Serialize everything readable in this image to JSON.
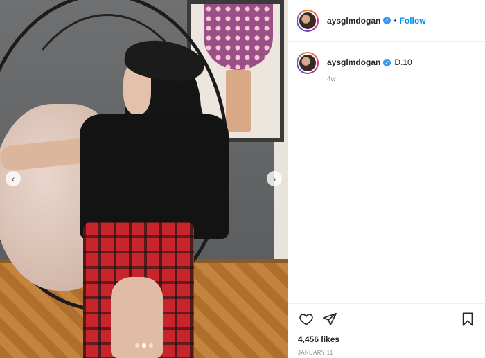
{
  "post": {
    "username": "aysglmdogan",
    "verified": true,
    "separator": "•",
    "follow_label": "Follow",
    "caption": {
      "username": "aysglmdogan",
      "text": "D.10",
      "time": "4w"
    },
    "likes": "4,456 likes",
    "date": "JANUARY 11"
  },
  "carousel": {
    "total_slides": 3,
    "active_slide": 1
  },
  "icons": {
    "like": "heart-icon",
    "share": "paper-plane-icon",
    "save": "bookmark-icon",
    "prev": "chevron-left-icon",
    "next": "chevron-right-icon",
    "verified": "verified-badge-icon"
  },
  "colors": {
    "accent": "#0095f6",
    "verified": "#3897f0",
    "muted": "#8e8e8e"
  }
}
